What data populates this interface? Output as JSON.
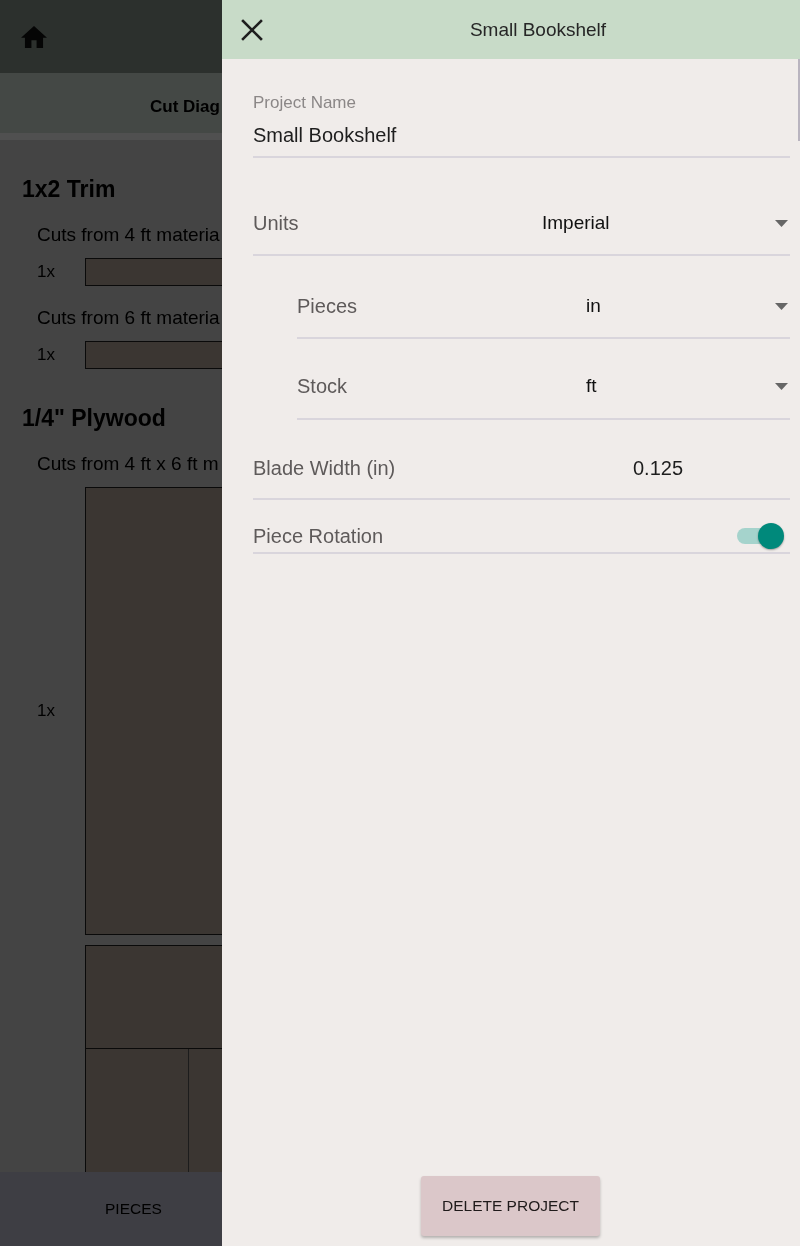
{
  "background": {
    "tab": {
      "label": "Cut Diag"
    },
    "sections": [
      {
        "title": "1x2 Trim",
        "groups": [
          {
            "caption": "Cuts from 4 ft materia",
            "layouts": [
              {
                "kind": "strip",
                "quantity": "1x"
              }
            ]
          },
          {
            "caption": "Cuts from 6 ft materia",
            "layouts": [
              {
                "kind": "strip",
                "quantity": "1x"
              }
            ]
          }
        ]
      },
      {
        "title": "1/4\" Plywood",
        "groups": [
          {
            "caption": "Cuts from 4 ft x 6 ft m",
            "layouts": [
              {
                "kind": "sheet",
                "quantity": "1x"
              },
              {
                "kind": "split_sheet"
              }
            ]
          }
        ]
      }
    ],
    "bottom_nav": [
      {
        "label": "PIECES"
      }
    ]
  },
  "drawer": {
    "title": "Small Bookshelf",
    "fields": [
      {
        "kind": "text",
        "label": "Project Name",
        "value": "Small Bookshelf"
      },
      {
        "kind": "dropdown",
        "label": "Units",
        "value": "Imperial",
        "children": [
          {
            "kind": "dropdown",
            "label": "Pieces",
            "value": "in"
          },
          {
            "kind": "dropdown",
            "label": "Stock",
            "value": "ft"
          }
        ]
      },
      {
        "kind": "number",
        "label": "Blade Width (in)",
        "value": "0.125"
      },
      {
        "kind": "toggle",
        "label": "Piece Rotation",
        "on": true
      }
    ],
    "delete_button": {
      "label": "DELETE PROJECT"
    }
  }
}
